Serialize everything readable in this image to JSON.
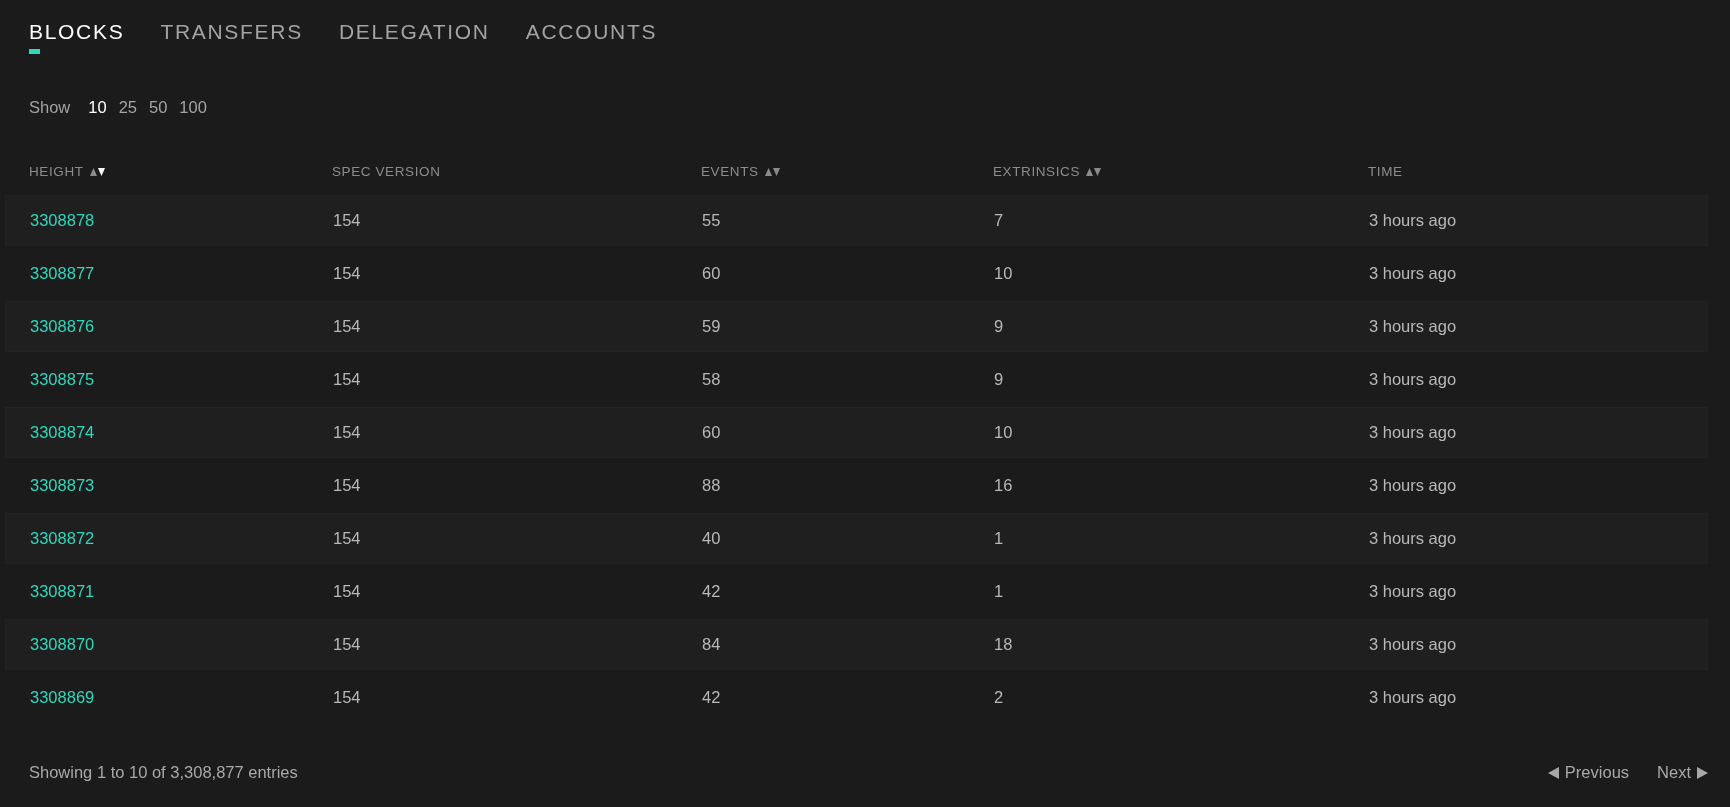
{
  "tabs": [
    {
      "label": "BLOCKS",
      "selected": true
    },
    {
      "label": "TRANSFERS",
      "selected": false
    },
    {
      "label": "DELEGATION",
      "selected": false
    },
    {
      "label": "ACCOUNTS",
      "selected": false
    }
  ],
  "page_size": {
    "label": "Show",
    "options": [
      {
        "label": "10",
        "selected": true
      },
      {
        "label": "25",
        "selected": false
      },
      {
        "label": "50",
        "selected": false
      },
      {
        "label": "100",
        "selected": false
      }
    ]
  },
  "table": {
    "columns": [
      {
        "label": "HEIGHT",
        "sortable": true,
        "sorted": true
      },
      {
        "label": "SPEC VERSION"
      },
      {
        "label": "EVENTS",
        "sortable": true,
        "sorted": false
      },
      {
        "label": "EXTRINSICS",
        "sortable": true,
        "sorted": false
      },
      {
        "label": "TIME"
      }
    ],
    "rows": [
      [
        "3308878",
        "154",
        "55",
        "7",
        "3 hours ago"
      ],
      [
        "3308877",
        "154",
        "60",
        "10",
        "3 hours ago"
      ],
      [
        "3308876",
        "154",
        "59",
        "9",
        "3 hours ago"
      ],
      [
        "3308875",
        "154",
        "58",
        "9",
        "3 hours ago"
      ],
      [
        "3308874",
        "154",
        "60",
        "10",
        "3 hours ago"
      ],
      [
        "3308873",
        "154",
        "88",
        "16",
        "3 hours ago"
      ],
      [
        "3308872",
        "154",
        "40",
        "1",
        "3 hours ago"
      ],
      [
        "3308871",
        "154",
        "42",
        "1",
        "3 hours ago"
      ],
      [
        "3308870",
        "154",
        "84",
        "18",
        "3 hours ago"
      ],
      [
        "3308869",
        "154",
        "42",
        "2",
        "3 hours ago"
      ]
    ]
  },
  "footer": {
    "summary": "Showing 1 to 10 of 3,308,877 entries",
    "previous": "Previous",
    "next": "Next"
  }
}
